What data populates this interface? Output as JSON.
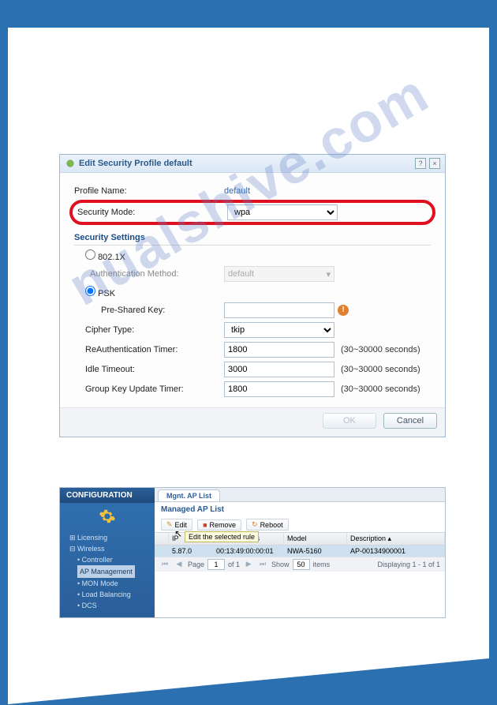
{
  "watermark": "nualshive.com",
  "dialog": {
    "title": "Edit Security Profile default",
    "profile_name_label": "Profile Name:",
    "profile_name_value": "default",
    "security_mode_label": "Security Mode:",
    "security_mode_value": "wpa",
    "section_header": "Security Settings",
    "r8021x_label": "802.1X",
    "auth_method_label": "Authentication Method:",
    "auth_method_value": "default",
    "psk_label": "PSK",
    "psk_key_label": "Pre-Shared Key:",
    "cipher_label": "Cipher Type:",
    "cipher_value": "tkip",
    "reauth_label": "ReAuthentication Timer:",
    "reauth_value": "1800",
    "idle_label": "Idle Timeout:",
    "idle_value": "3000",
    "group_label": "Group Key Update Timer:",
    "group_value": "1800",
    "range_hint": "(30~30000 seconds)",
    "ok_label": "OK",
    "cancel_label": "Cancel"
  },
  "panel": {
    "sidebar_header": "CONFIGURATION",
    "tree": {
      "licensing": "Licensing",
      "wireless": "Wireless",
      "controller": "Controller",
      "ap_mgmt": "AP Management",
      "mon_mode": "MON Mode",
      "load_bal": "Load Balancing",
      "dcs": "DCS"
    },
    "tab_label": "Mgnt. AP List",
    "list_header": "Managed AP List",
    "toolbar": {
      "edit": "Edit",
      "remove": "Remove",
      "reboot": "Reboot",
      "tooltip": "Edit the selected rule"
    },
    "columns": {
      "ip": "IP",
      "mac": "MAC Address",
      "model": "Model",
      "desc": "Description"
    },
    "row": {
      "ip": "5.87.0",
      "mac": "00:13:49:00:00:01",
      "model": "NWA-5160",
      "desc": "AP-00134900001"
    },
    "pager": {
      "page_label": "Page",
      "page_value": "1",
      "of_label": "of 1",
      "show_label": "Show",
      "show_value": "50",
      "items_label": "items",
      "display": "Displaying 1 - 1 of 1"
    }
  }
}
